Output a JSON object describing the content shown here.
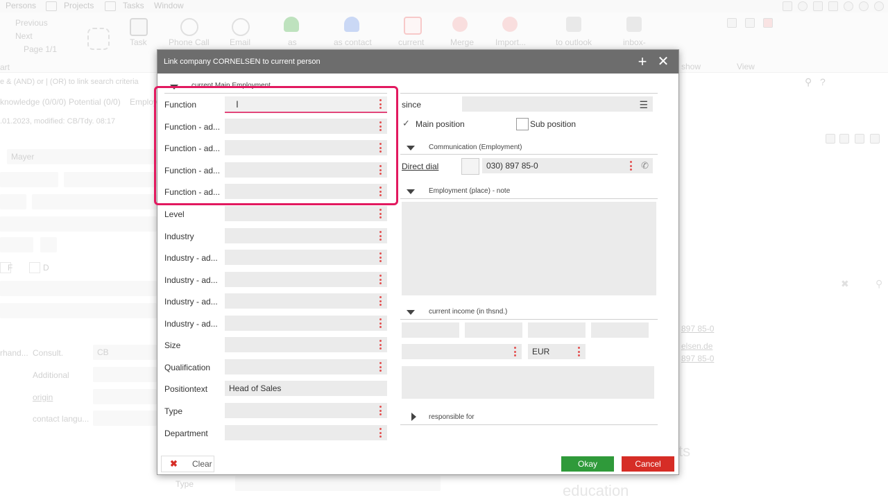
{
  "menubar": {
    "items": [
      "Persons",
      "Projects",
      "Tasks",
      "Window"
    ]
  },
  "ribbon": {
    "nav": [
      "Previous",
      "Next",
      "Page 1/1"
    ],
    "buttons": [
      "Task",
      "Phone Call",
      "Email",
      "as",
      "as contact",
      "current",
      "Merge",
      "Import...",
      "to outlook",
      "inbox-"
    ],
    "right_labels": [
      "show",
      "View"
    ],
    "left_label": "art"
  },
  "background": {
    "search_hint": "e & (AND) or | (OR) to link search criteria",
    "tabs": [
      "knowledge (0/0/0)",
      "Potential (0/0)",
      "Employ"
    ],
    "modified": ".01.2023, modified: CB/Tdy. 08:17",
    "name": "Mayer",
    "check_f": "F",
    "check_d": "D",
    "labels": [
      "rhand...",
      "Consult.",
      "Additional",
      "origin",
      "contact langu..."
    ],
    "consult_value": "CB",
    "type_label": "Type",
    "right_phone1": "897 85-0",
    "right_email": "elsen.de",
    "right_phone2": "897 85-0",
    "right_big1": "ts",
    "right_big2": "education"
  },
  "dialog": {
    "title": "Link company CORNELSEN to current person",
    "section_main": "current Main Employment",
    "left_fields": [
      {
        "label": "Function",
        "value": ""
      },
      {
        "label": "Function - ad...",
        "value": ""
      },
      {
        "label": "Function - ad...",
        "value": ""
      },
      {
        "label": "Function - ad...",
        "value": ""
      },
      {
        "label": "Function - ad...",
        "value": ""
      },
      {
        "label": "Level",
        "value": ""
      },
      {
        "label": "Industry",
        "value": ""
      },
      {
        "label": "Industry - ad...",
        "value": ""
      },
      {
        "label": "Industry - ad...",
        "value": ""
      },
      {
        "label": "Industry - ad...",
        "value": ""
      },
      {
        "label": "Industry - ad...",
        "value": ""
      },
      {
        "label": "Size",
        "value": ""
      },
      {
        "label": "Qualification",
        "value": ""
      },
      {
        "label": "Positiontext",
        "value": "Head of Sales"
      },
      {
        "label": "Type",
        "value": ""
      },
      {
        "label": "Department",
        "value": ""
      }
    ],
    "since_label": "since",
    "main_position": "Main position",
    "sub_position": "Sub position",
    "main_position_checked": true,
    "sub_position_checked": false,
    "section_comm": "Communication (Employment)",
    "direct_dial_label": "Direct dial",
    "direct_dial_value": "030) 897 85-0",
    "section_note": "Employment (place) - note",
    "section_income": "current income (in thsnd.)",
    "currency": "EUR",
    "section_responsible": "responsible for",
    "clear_label": "Clear",
    "okay_label": "Okay",
    "cancel_label": "Cancel"
  },
  "colors": {
    "highlight": "#e2195f",
    "okay": "#2f9a3a",
    "cancel": "#d62d26",
    "title_bar": "#6d6d6d"
  }
}
